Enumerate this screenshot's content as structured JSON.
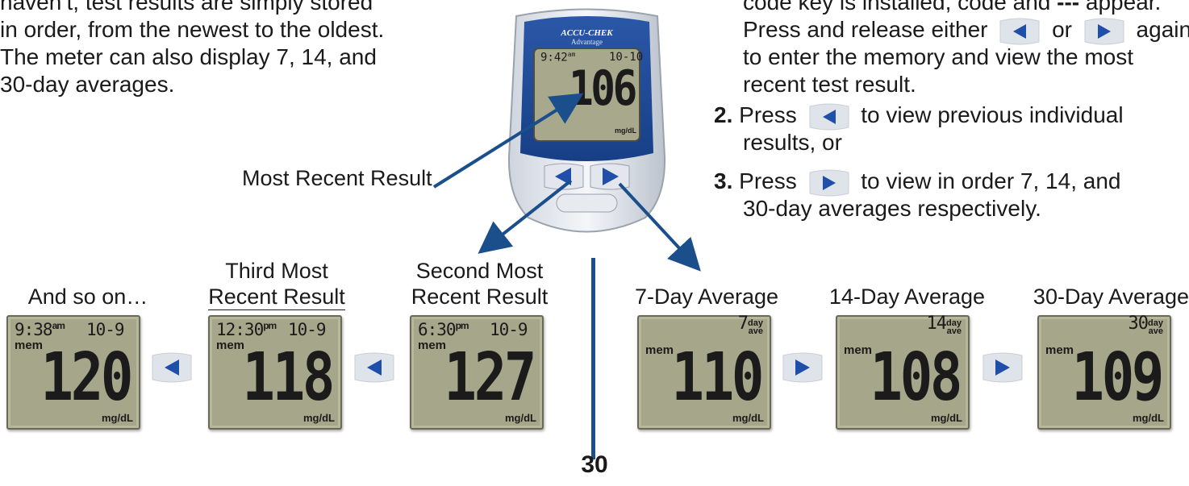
{
  "intro": {
    "line1": "haven’t, test results are simply stored",
    "line2": "in order, from the newest to the oldest.",
    "line3": "The meter can also display 7, 14, and",
    "line4": "30-day averages."
  },
  "steps": {
    "s1_line1_a": "code key is installed, code and",
    "s1_line1_dashes": "---",
    "s1_line1_b": "appear.",
    "s1_line2_a": "Press and release either",
    "s1_line2_or": "or",
    "s1_line2_b": "again",
    "s1_line3": "to enter the memory and view the most",
    "s1_line4": "recent test result.",
    "s2_num": "2.",
    "s2_a": "Press",
    "s2_b": "to view previous individual",
    "s2_c": "results, or",
    "s3_num": "3.",
    "s3_a": "Press",
    "s3_b": "to view in order 7, 14, and",
    "s3_c": "30-day averages respectively."
  },
  "meter": {
    "brand": "ACCU-CHEK",
    "model": "Advantage",
    "time": "9:42",
    "time_suffix": "am",
    "date": "10-10",
    "value": "106",
    "unit": "mg/dL"
  },
  "most_recent_label": "Most Recent Result",
  "displays": [
    {
      "label_line1": "",
      "label_line2": "And so on…",
      "time": "9:38",
      "time_suffix": "am",
      "date": "10-9",
      "mem": "mem",
      "value": "120",
      "unit": "mg/dL"
    },
    {
      "label_line1": "Third Most",
      "label_line2": "Recent Result",
      "time": "12:30",
      "time_suffix": "pm",
      "date": "10-9",
      "mem": "mem",
      "value": "118",
      "unit": "mg/dL"
    },
    {
      "label_line1": "Second Most",
      "label_line2": "Recent Result",
      "time": "6:30",
      "time_suffix": "pm",
      "date": "10-9",
      "mem": "mem",
      "value": "127",
      "unit": "mg/dL"
    },
    {
      "label_line1": "",
      "label_line2": "7-Day Average",
      "avg_n": "7",
      "avg_day": "day",
      "avg_ave": "ave",
      "mem": "mem",
      "value": "110",
      "unit": "mg/dL"
    },
    {
      "label_line1": "",
      "label_line2": "14-Day Average",
      "avg_n": "14",
      "avg_day": "day",
      "avg_ave": "ave",
      "mem": "mem",
      "value": "108",
      "unit": "mg/dL"
    },
    {
      "label_line1": "",
      "label_line2": "30-Day Average",
      "avg_n": "30",
      "avg_day": "day",
      "avg_ave": "ave",
      "mem": "mem",
      "value": "109",
      "unit": "mg/dL"
    }
  ],
  "page_number": "30",
  "colors": {
    "accent": "#1a4f8c",
    "lcd": "#a6a68a",
    "button_blue": "#1f4fa8"
  },
  "icons": {
    "left_button": "left-triangle-button-icon",
    "right_button": "right-triangle-button-icon"
  }
}
